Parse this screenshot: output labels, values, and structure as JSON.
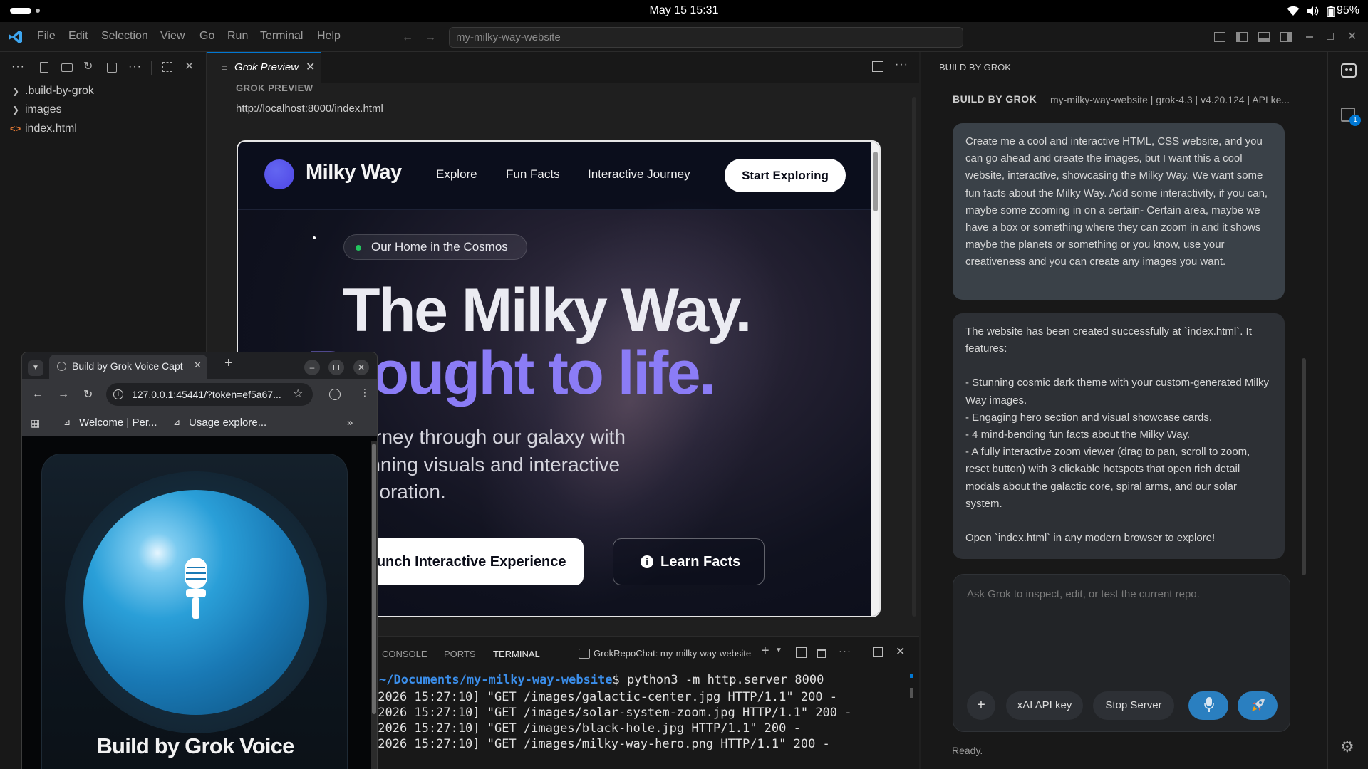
{
  "os": {
    "datetime": "May 15  15:31",
    "battery": "95%"
  },
  "vscode": {
    "menu": [
      "File",
      "Edit",
      "Selection",
      "View",
      "Go",
      "Run",
      "Terminal",
      "Help"
    ],
    "search": "my-milky-way-website",
    "explorer": [
      ".build-by-grok",
      "images",
      "index.html"
    ],
    "tab_title": "Grok Preview",
    "preview_label": "GROK PREVIEW",
    "preview_url": "http://localhost:8000/index.html"
  },
  "site": {
    "brand": "Milky Way",
    "nav": [
      "Explore",
      "Fun Facts",
      "Interactive Journey"
    ],
    "cta": "Start Exploring",
    "badge": "Our Home in the Cosmos",
    "headline1": "The Milky Way.",
    "headline2": "Brought to life.",
    "sub1": "Journey through our galaxy with",
    "sub2": "stunning visuals and interactive",
    "sub3": "exploration.",
    "btn_primary": "Launch Interactive Experience",
    "btn_secondary": "Learn Facts"
  },
  "panel": {
    "tabs": [
      "CONSOLE",
      "PORTS",
      "TERMINAL"
    ],
    "terminal_name": "GrokRepoChat: my-milky-way-website",
    "prompt_path": "~/Documents/my-milky-way-website",
    "prompt_cmd": "$ python3 -m http.server 8000",
    "log": [
      "[2026 15:27:10] \"GET /images/galactic-center.jpg HTTP/1.1\" 200 -",
      "[2026 15:27:10] \"GET /images/solar-system-zoom.jpg HTTP/1.1\" 200 -",
      "[2026 15:27:10] \"GET /images/black-hole.jpg HTTP/1.1\" 200 -",
      "[2026 15:27:10] \"GET /images/milky-way-hero.png HTTP/1.1\" 200 -"
    ]
  },
  "grok": {
    "pane_title": "BUILD BY GROK",
    "header_title": "BUILD BY GROK",
    "header_meta": "my-milky-way-website | grok-4.3 | v4.20.124 | API ke...",
    "user_msg": "Create me a cool and interactive HTML, CSS website, and you can go ahead and create the images, but I want this a cool website, interactive, showcasing the Milky Way. We want some fun facts about the Milky Way. Add some interactivity, if you can, maybe some zooming in on a certain- Certain area, maybe we have a box or something where they can zoom in and it shows maybe the planets or something or you know, use your creativeness and you can create any images you want.",
    "reply_intro": "The website has been created successfully at `index.html`. It features:",
    "reply_items": [
      "- Stunning cosmic dark theme with your custom-generated Milky Way images.",
      "- Engaging hero section and visual showcase cards.",
      "- 4 mind-bending fun facts about the Milky Way.",
      "- A fully interactive zoom viewer (drag to pan, scroll to zoom, reset button) with 3 clickable hotspots that open rich detail modals about the galactic core, spiral arms, and our solar system."
    ],
    "reply_outro": "Open `index.html` in any modern browser to explore!",
    "input_placeholder": "Ask Grok to inspect, edit, or test the current repo.",
    "btn_plus": "+",
    "btn_key": "xAI API key",
    "btn_stop": "Stop Server",
    "status": "Ready.",
    "badge_count": "1"
  },
  "browser": {
    "tab_title": "Build by Grok Voice Capt",
    "url": "127.0.0.1:45441/?token=ef5a67...",
    "bookmarks": [
      "Welcome | Per...",
      "Usage explore..."
    ],
    "voice_title": "Build by Grok Voice"
  }
}
